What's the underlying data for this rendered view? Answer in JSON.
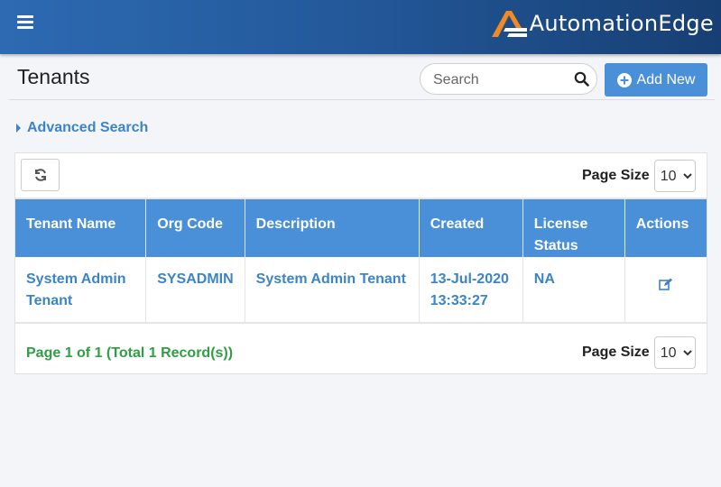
{
  "brand": {
    "name": "AutomationEdge"
  },
  "page": {
    "title": "Tenants"
  },
  "search": {
    "placeholder": "Search"
  },
  "actions": {
    "add_new": "Add New",
    "advanced_search": "Advanced Search"
  },
  "table": {
    "page_size_label": "Page Size",
    "page_size_value": "10",
    "page_size_options": [
      "10"
    ],
    "columns": [
      "Tenant Name",
      "Org Code",
      "Description",
      "Created",
      "License Status",
      "Actions"
    ],
    "rows": [
      {
        "tenant_name": "System Admin Tenant",
        "org_code": "SYSADMIN",
        "description": "System Admin Tenant",
        "created": "13-Jul-2020 13:33:27",
        "license_status": "NA",
        "action_icon": "edit-icon"
      }
    ]
  },
  "pager": {
    "summary": "Page 1 of 1 (Total 1 Record(s))"
  },
  "colors": {
    "accent": "#4a90d9",
    "link": "#3d84c6",
    "success": "#2f9e44",
    "brand_orange": "#f08a24",
    "topbar_start": "#2d6ab2",
    "topbar_end": "#173f73"
  }
}
